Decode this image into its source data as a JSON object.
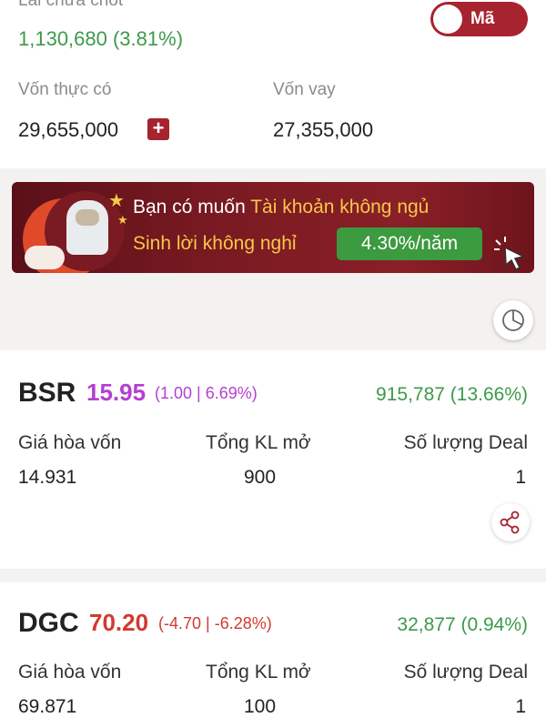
{
  "summary": {
    "realized_label": "Lãi chưa chốt",
    "realized_value": "1,130,680 (3.81%)",
    "toggle_label": "Mã",
    "own_capital_label": "Vốn thực có",
    "own_capital_value": "29,655,000",
    "plus_label": "+",
    "loan_label": "Vốn vay",
    "loan_value": "27,355,000"
  },
  "banner": {
    "line1_prefix": "Bạn có muốn ",
    "line1_highlight": "Tài khoản không ngủ",
    "line2": "Sinh lời không nghỉ",
    "rate": "4.30%/năm"
  },
  "positions": [
    {
      "symbol": "BSR",
      "price": "15.95",
      "change": "(1.00 | 6.69%)",
      "pl": "915,787 (13.66%)",
      "cols": [
        "Giá hòa vốn",
        "Tổng KL mở",
        "Số lượng Deal"
      ],
      "vals": [
        "14.931",
        "900",
        "1"
      ]
    },
    {
      "symbol": "DGC",
      "price": "70.20",
      "change": "(-4.70 | -6.28%)",
      "pl": "32,877 (0.94%)",
      "cols": [
        "Giá hòa vốn",
        "Tổng KL mở",
        "Số lượng Deal"
      ],
      "vals": [
        "69.871",
        "100",
        "1"
      ]
    }
  ],
  "colors": {
    "accent": "#a6232f",
    "gain": "#3d9a4a",
    "loss": "#d23a2e",
    "ceiling": "#b43fd1"
  }
}
